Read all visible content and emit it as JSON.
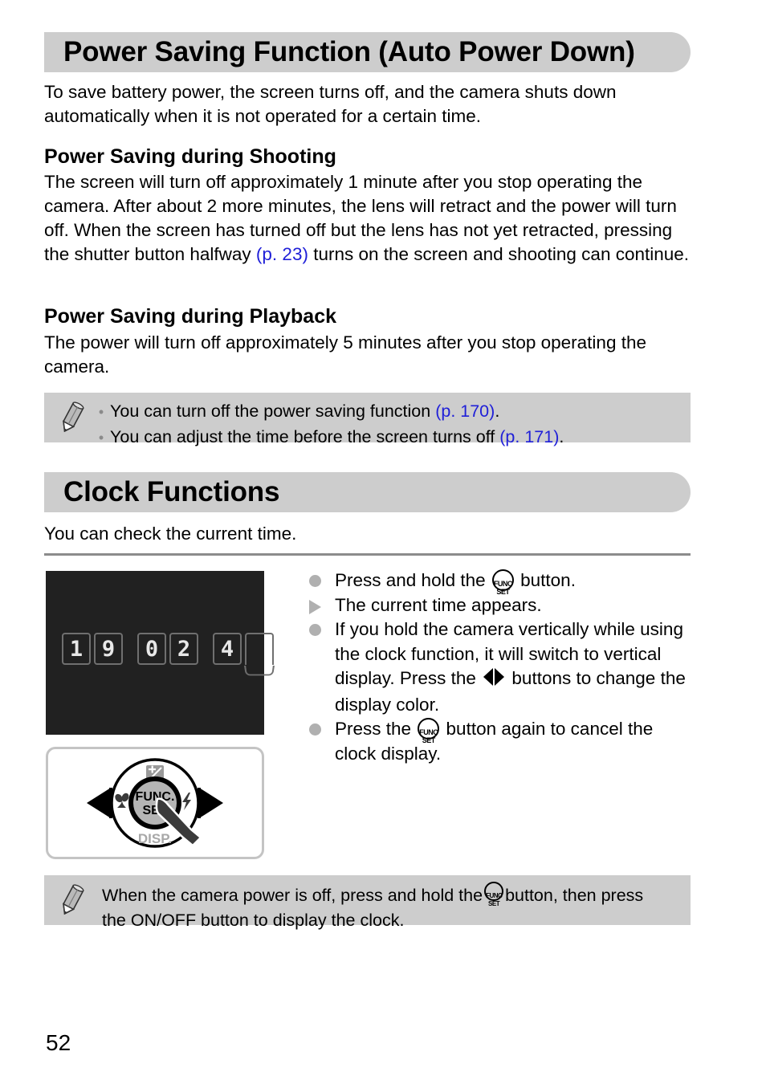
{
  "page": {
    "number": "52"
  },
  "sections": [
    {
      "title": "Power Saving Function (Auto Power Down)",
      "intro": "To save battery power, the screen turns off, and the camera shuts down automatically when it is not operated for a certain time.",
      "subsections": [
        {
          "heading": "Power Saving during Shooting",
          "text_before_ref": "The screen will turn off approximately 1 minute after you stop operating the camera. After about 2 more minutes, the lens will retract and the power will turn off. When the screen has turned off but the lens has not yet retracted, pressing the shutter button halfway ",
          "ref": "(p. 23)",
          "text_after_ref": " turns on the screen and shooting can continue."
        },
        {
          "heading": "Power Saving during Playback",
          "text": "The power will turn off approximately 5 minutes after you stop operating the camera."
        }
      ],
      "note": {
        "icon": "pencil-icon",
        "bullets": [
          {
            "marker": "•",
            "text_before_ref": "You can turn off the power saving function ",
            "ref": "(p. 170)",
            "text_after_ref": "."
          },
          {
            "marker": "•",
            "text_before_ref": "You can adjust the time before the screen turns off ",
            "ref": "(p. 171)",
            "text_after_ref": "."
          }
        ]
      }
    },
    {
      "title": "Clock Functions",
      "intro": "You can check the current time."
    }
  ],
  "clock": {
    "lcd": {
      "digits": [
        "1",
        "9",
        "0",
        "2",
        "4"
      ],
      "rolling_digit": ""
    },
    "dial": {
      "center_top_label": "FUNC.",
      "center_bottom_label": "SET",
      "bottom_label": "DISP.",
      "top_icon": "exposure-compensation-icon",
      "left_icon": "macro-flower-icon",
      "right_icon": "flash-bolt-icon",
      "cursor_icon": "hand-pointer-icon"
    },
    "instructions": [
      {
        "marker": "dot",
        "parts": [
          {
            "type": "text",
            "value": "Press and hold the "
          },
          {
            "type": "funcset"
          },
          {
            "type": "text",
            "value": " button."
          }
        ]
      },
      {
        "marker": "triangle",
        "parts": [
          {
            "type": "text",
            "value": "The current time appears."
          }
        ]
      },
      {
        "marker": "dot",
        "parts": [
          {
            "type": "text",
            "value": "If you hold the camera vertically while using the clock function, it will switch to vertical display. Press the "
          },
          {
            "type": "lrarrows"
          },
          {
            "type": "text",
            "value": " buttons to change the display color."
          }
        ]
      },
      {
        "marker": "dot",
        "parts": [
          {
            "type": "text",
            "value": "Press the "
          },
          {
            "type": "funcset"
          },
          {
            "type": "text",
            "value": " button again to cancel the clock display."
          }
        ]
      }
    ],
    "note": {
      "icon": "pencil-icon",
      "line1_before": "When the camera power is off, press and hold the ",
      "line1_after": " button, then press",
      "line2": "the ON/OFF button to display the clock."
    }
  },
  "colors": {
    "bar_background": "#cdcdcd",
    "note_background": "#cdcdcd",
    "reference_link": "#2020d8",
    "bullet_gray": "#b0b0b0",
    "lcd_background": "#212121",
    "divider": "#8c8c8c"
  }
}
